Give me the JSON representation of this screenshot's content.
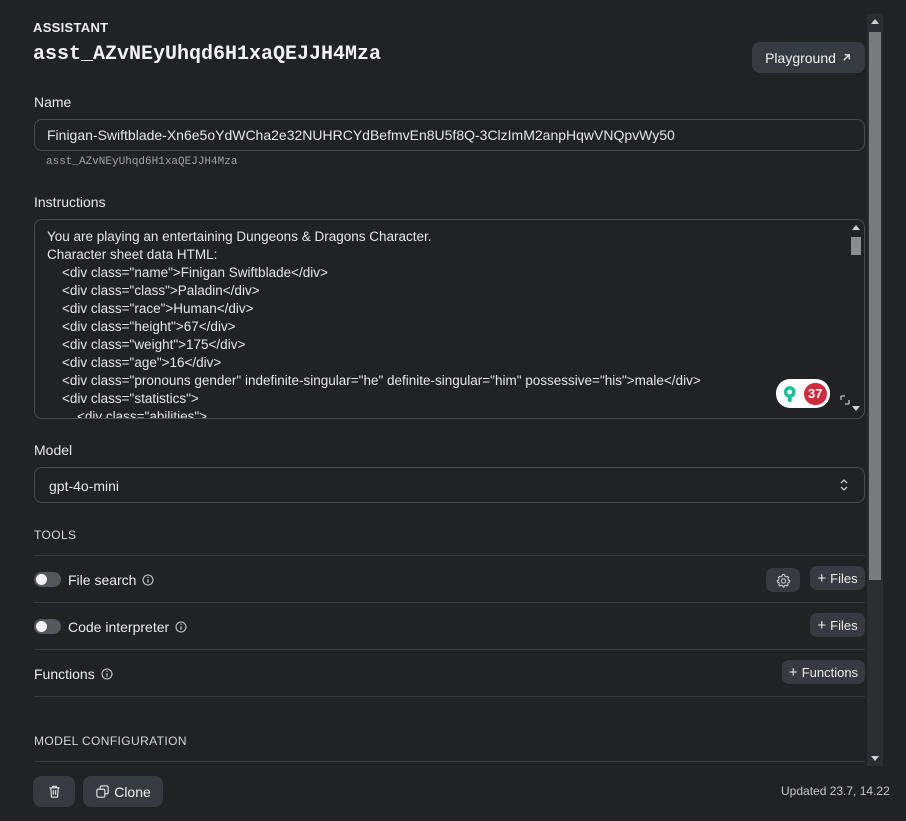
{
  "header": {
    "eyebrow": "ASSISTANT",
    "assistant_id": "asst_AZvNEyUhqd6H1xaQEJJH4Mza",
    "playground_label": "Playground"
  },
  "name": {
    "label": "Name",
    "value": "Finigan-Swiftblade-Xn6e5oYdWCha2e32NUHRCYdBefmvEn8U5f8Q-3ClzImM2anpHqwVNQpvWy50",
    "sub_id": "asst_AZvNEyUhqd6H1xaQEJJH4Mza"
  },
  "instructions": {
    "label": "Instructions",
    "lines": [
      "You are playing an entertaining Dungeons & Dragons Character.",
      "Character sheet data HTML:",
      "    <div class=\"name\">Finigan Swiftblade</div>",
      "    <div class=\"class\">Paladin</div>",
      "    <div class=\"race\">Human</div>",
      "    <div class=\"height\">67</div>",
      "    <div class=\"weight\">175</div>",
      "    <div class=\"age\">16</div>",
      "    <div class=\"pronouns gender\" indefinite-singular=\"he\" definite-singular=\"him\" possessive=\"his\">male</div>",
      "    <div class=\"statistics\">",
      "        <div class=\"abilities\">"
    ],
    "grammarly_count": "37"
  },
  "model": {
    "label": "Model",
    "value": "gpt-4o-mini"
  },
  "tools": {
    "heading": "TOOLS",
    "file_search_label": "File search",
    "code_interpreter_label": "Code interpreter",
    "functions_label": "Functions",
    "files_button_label": "Files",
    "functions_button_label": "Functions"
  },
  "model_configuration": {
    "heading": "MODEL CONFIGURATION"
  },
  "footer": {
    "clone_label": "Clone",
    "updated_text": "Updated 23.7, 14.22"
  },
  "colors": {
    "background": "#212224",
    "button": "#383a41",
    "grammarly_red": "#d2293d",
    "grammarly_green": "#15c39a"
  },
  "icons": [
    "external-arrow-icon",
    "chevron-updown-icon",
    "info-icon",
    "gear-icon",
    "plus-icon",
    "trash-icon",
    "copy-icon",
    "resize-icon",
    "grammarly-icon"
  ]
}
